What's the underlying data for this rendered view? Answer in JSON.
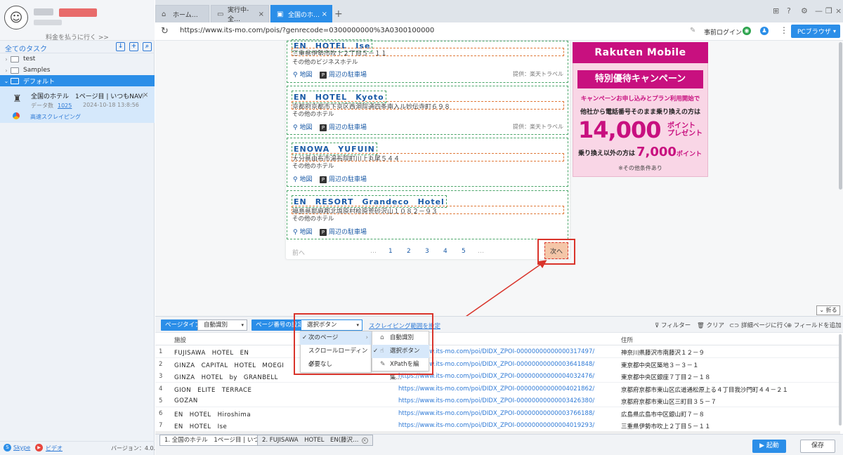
{
  "sidebar": {
    "pay_link": "料金を払うに行く >>",
    "all_tasks": "全てのタスク",
    "folders": [
      {
        "label": "test"
      },
      {
        "label": "Samples"
      },
      {
        "label": "デフォルト"
      }
    ],
    "task": {
      "title": "全国のホテル　1ページ目 | いつもNAVI-ス…",
      "count_label": "データ数",
      "count": "1025",
      "date": "2024-10-18 13:8:56",
      "speed": "高速スクレイピング"
    },
    "footer": {
      "skype": "Skype",
      "video": "ビデオ",
      "version": "バージョン：4.0.2"
    }
  },
  "tabs": [
    {
      "label": "ホーム…"
    },
    {
      "label": "実行中-全…"
    },
    {
      "label": "全国のホ…"
    }
  ],
  "address": {
    "url": "https://www.its-mo.com/pois/?genrecode=0300000000%3A0300100000",
    "login": "事前ログイン",
    "browser": "PCブラウザ"
  },
  "hotels": [
    {
      "name": "EN　HOTEL　Ise",
      "address": "三重県伊勢市吹上２丁目５－１１",
      "category": "その他のビジネスホテル",
      "map": "地図",
      "parking": "周辺の駐車場",
      "provider": "提供：楽天トラベル"
    },
    {
      "name": "EN　HOTEL　Kyoto",
      "address": "京都府京都市下京区西洞院通四条南入ル妙伝寺町６９８",
      "category": "その他のホテル",
      "map": "地図",
      "parking": "周辺の駐車場",
      "provider": "提供：楽天トラベル"
    },
    {
      "name": "ENOWA　YUFUIN",
      "address": "大分県由布市湯布院町川上丸尾５４４",
      "category": "その他のホテル",
      "map": "地図",
      "parking": "周辺の駐車場",
      "provider": ""
    },
    {
      "name": "EN　RESORT　Grandeco　Hotel",
      "address": "福島県耶麻郡北塩原村桧原荒砂沢山１０８２－９３",
      "category": "その他のホテル",
      "map": "地図",
      "parking": "周辺の駐車場",
      "provider": ""
    }
  ],
  "pager": {
    "prev": "前へ",
    "ellipsis": "…",
    "pages": [
      "1",
      "2",
      "3",
      "4",
      "5"
    ],
    "next": "次へ"
  },
  "ad": {
    "brand": "Rakuten Mobile",
    "banner": "特別優待キャンペーン",
    "line1": "キャンペーンお申し込みとプラン利用開始で",
    "line2": "他社から電話番号そのまま乗り換えの方は",
    "big": "14,000",
    "big_unit": "ポイント",
    "big_unit2": "プレゼント",
    "line3": "乗り換え以外の方は",
    "small_big": "7,000",
    "small_unit": "ポイント",
    "note": "※その他条件あり"
  },
  "toolbar": {
    "page_type": "ページタイプ",
    "page_type_value": "自動識別",
    "page_number": "ページ番号の設定",
    "page_number_value": "選択ボタン",
    "scrape_range": "スクレイピング範囲を設定",
    "filter": "フィルター",
    "clear": "クリア",
    "detail": "詳細ページに行く",
    "add_field": "フィールドを追加",
    "collapse": "折る"
  },
  "dropdown": {
    "level1": [
      "次のページ",
      "スクロールローディング",
      "必要なし"
    ],
    "level2": [
      "自動識別",
      "選択ボタン",
      "XPathを編集…"
    ]
  },
  "table": {
    "headers": [
      "施設",
      "",
      "住所"
    ],
    "rows": [
      {
        "n": "1",
        "name": "FUJISAWA　HOTEL　EN",
        "url": "https://www.its-mo.com/poi/DIDX_ZPOI-00000000000000317497/",
        "addr": "神奈川県藤沢市南藤沢１２－９"
      },
      {
        "n": "2",
        "name": "GINZA　CAPITAL　HOTEL　MOEGI",
        "url": "https://www.its-mo.com/poi/DIDX_ZPOI-00000000000003641848/",
        "addr": "東京都中央区築地３－３－１"
      },
      {
        "n": "3",
        "name": "GINZA　HOTEL　by　GRANBELL",
        "url": "https://www.its-mo.com/poi/DIDX_ZPOI-00000000000004032476/",
        "addr": "東京都中央区銀座７丁目２－１８"
      },
      {
        "n": "4",
        "name": "GION　ELITE　TERRACE",
        "url": "https://www.its-mo.com/poi/DIDX_ZPOI-00000000000004021862/",
        "addr": "京都府京都市東山区広道通松原上る４丁目我沙門町４４－２１"
      },
      {
        "n": "5",
        "name": "GOZAN",
        "url": "https://www.its-mo.com/poi/DIDX_ZPOI-00000000000003426380/",
        "addr": "京都府京都市東山区三町目３５－７"
      },
      {
        "n": "6",
        "name": "EN　HOTEL　Hiroshima",
        "url": "https://www.its-mo.com/poi/DIDX_ZPOI-00000000000003766188/",
        "addr": "広島県広島市中区銀山町７－８"
      },
      {
        "n": "7",
        "name": "EN　HOTEL　Ise",
        "url": "https://www.its-mo.com/poi/DIDX_ZPOI-00000000000004019293/",
        "addr": "三重県伊勢市吹上２丁目５－１１"
      }
    ]
  },
  "bottom_tabs": [
    "1. 全国のホテル　1ページ目 | いつ…",
    "2. FUJISAWA　HOTEL　EN(藤沢…"
  ],
  "actions": {
    "start": "▶ 起動",
    "save": "保存"
  },
  "colors": {
    "accent": "#2b8ee8",
    "highlight_red": "#d9342b",
    "rakuten": "#c8107f"
  }
}
